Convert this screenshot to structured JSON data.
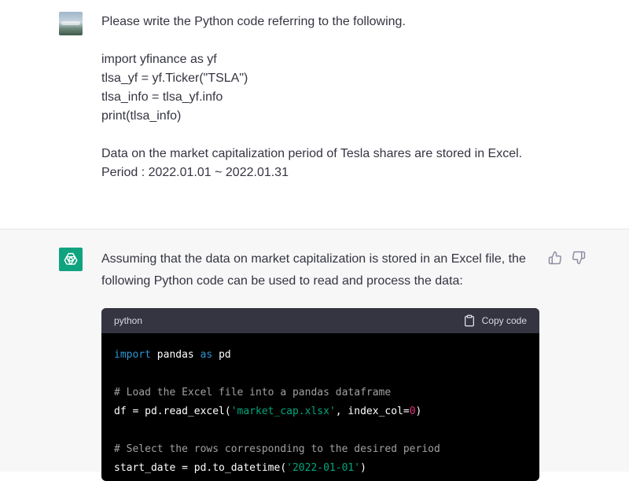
{
  "user_message": {
    "lines": [
      "Please write the Python code referring to the following.",
      "",
      "import yfinance as yf",
      "tlsa_yf = yf.Ticker(\"TSLA\")",
      "tlsa_info = tlsa_yf.info",
      "print(tlsa_info)",
      "",
      "Data on the market capitalization period of Tesla shares are stored in Excel.",
      "Period : 2022.01.01 ~ 2022.01.31"
    ]
  },
  "assistant_message": {
    "intro": "Assuming that the data on market capitalization is stored in an Excel file, the following Python code can be used to read and process the data:",
    "code_language": "python",
    "copy_label": "Copy code",
    "code": {
      "l1_kw1": "import",
      "l1_mod": " pandas ",
      "l1_kw2": "as",
      "l1_alias": " pd",
      "l3_comment": "# Load the Excel file into a pandas dataframe",
      "l4_a": "df = pd.read_excel(",
      "l4_str": "'market_cap.xlsx'",
      "l4_b": ", index_col=",
      "l4_num": "0",
      "l4_c": ")",
      "l6_comment": "# Select the rows corresponding to the desired period",
      "l7_a": "start_date = pd.to_datetime(",
      "l7_str": "'2022-01-01'",
      "l7_c": ")"
    }
  },
  "colors": {
    "gpt_avatar": "#10a37f",
    "assistant_bg": "#f7f7f8",
    "code_bg": "#000000",
    "code_header_bg": "#343541"
  },
  "icons": [
    "user-avatar",
    "chatgpt-logo-icon",
    "thumbs-up-icon",
    "thumbs-down-icon",
    "clipboard-icon"
  ]
}
